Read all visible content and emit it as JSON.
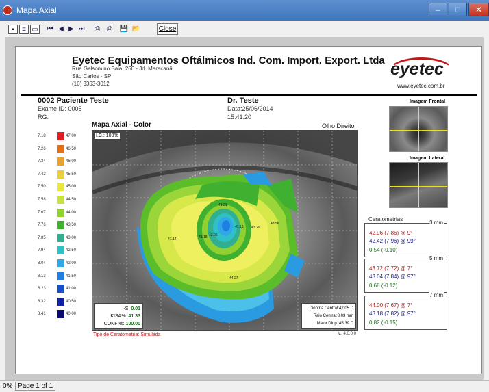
{
  "window": {
    "title": "Mapa Axial",
    "close_label": "Close"
  },
  "status": {
    "zoom": "0%",
    "page": "Page 1 of 1"
  },
  "header": {
    "company": "Eyetec Equipamentos Oftálmicos Ind. Com. Import. Export. Ltda",
    "address1": "Rua Gelsomino Saia, 260 - Jd. Maracanã",
    "address2": "São Carlos - SP",
    "phone": "(16) 3363-3012",
    "logo": "eyetec",
    "url": "www.eyetec.com.br"
  },
  "patient": {
    "name": "0002 Paciente Teste",
    "exam_id": "Exame ID: 0005",
    "rg": "RG:",
    "doctor": "Dr. Teste",
    "date": "Data:25/06/2014",
    "time": "15:41:20"
  },
  "map": {
    "title": "Mapa Axial - Color",
    "eye": "Olho Direito",
    "ic": "I.C.: 100%",
    "is_label": "I-S:",
    "is_value": "0.01",
    "kisa_label": "KISA%:",
    "kisa_value": "41.33",
    "conf_label": "CONF %:",
    "conf_value": "100.00",
    "dioptria": "Dioptria Central:42.05 D",
    "raio": "Raio Central:8.03 mm",
    "maior": "Maior Diop.:45.39 D",
    "labels": [
      "41.14",
      "41.13",
      "41.18",
      "43.06",
      "43.21",
      "43.29",
      "43.56",
      "44.27"
    ],
    "tipo": "Tipo de Ceratometria: Simulada",
    "version": "v.: 4.0.0.0"
  },
  "scale": [
    {
      "mm": "7.18",
      "d": "47.00",
      "color": "#e02020"
    },
    {
      "mm": "7.26",
      "d": "46.50",
      "color": "#e07020"
    },
    {
      "mm": "7.34",
      "d": "46.00",
      "color": "#e8a030"
    },
    {
      "mm": "7.42",
      "d": "45.50",
      "color": "#e8d040"
    },
    {
      "mm": "7.50",
      "d": "45.00",
      "color": "#e8e840"
    },
    {
      "mm": "7.58",
      "d": "44.50",
      "color": "#c8e040"
    },
    {
      "mm": "7.67",
      "d": "44.00",
      "color": "#90d030"
    },
    {
      "mm": "7.76",
      "d": "43.50",
      "color": "#40b030"
    },
    {
      "mm": "7.85",
      "d": "43.00",
      "color": "#30b090"
    },
    {
      "mm": "7.94",
      "d": "42.50",
      "color": "#30c0c8"
    },
    {
      "mm": "8.04",
      "d": "42.00",
      "color": "#30a8e8"
    },
    {
      "mm": "8.13",
      "d": "41.50",
      "color": "#2080e0"
    },
    {
      "mm": "8.23",
      "d": "41.00",
      "color": "#1850c8"
    },
    {
      "mm": "8.32",
      "d": "40.50",
      "color": "#1020a0"
    },
    {
      "mm": "8.41",
      "d": "40.00",
      "color": "#0a0a70"
    }
  ],
  "photos": {
    "frontal": "Imagem Frontal",
    "lateral": "Imagem Lateral"
  },
  "keratometry": {
    "title": "Ceratometrias",
    "groups": [
      {
        "mm": "3 mm",
        "k1": "42.96 (7.86) @ 9°",
        "k2": "42.42 (7.96) @ 99°",
        "cyl": "0.54 (-0.10)"
      },
      {
        "mm": "5 mm",
        "k1": "43.72 (7.72) @ 7°",
        "k2": "43.04 (7.84) @ 97°",
        "cyl": "0.68 (-0.12)"
      },
      {
        "mm": "7 mm",
        "k1": "44.00 (7.67) @ 7°",
        "k2": "43.18 (7.82) @ 97°",
        "cyl": "0.82 (-0.15)"
      }
    ]
  },
  "colors": {
    "k1": "#b02020",
    "k2": "#20208a",
    "cyl": "#207020",
    "tipo": "#c02020"
  }
}
